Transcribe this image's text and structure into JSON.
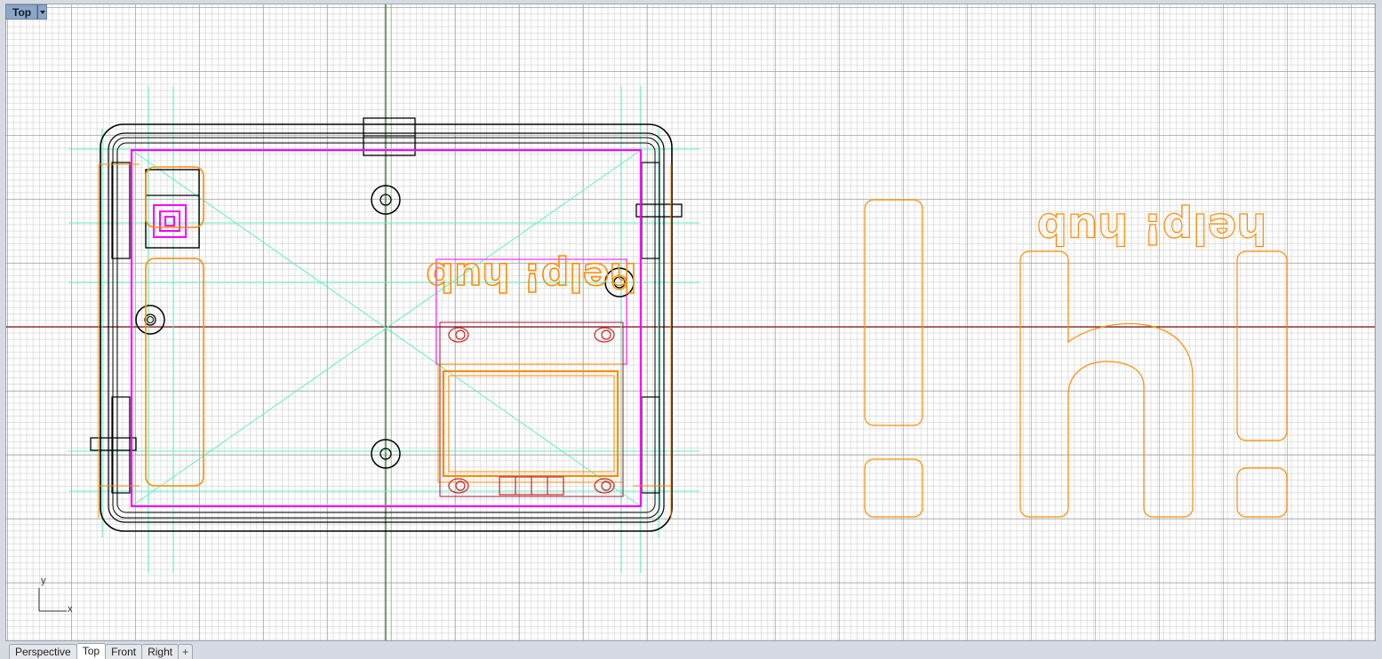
{
  "viewport": {
    "name": "Top",
    "text_mirrored": "help! hub",
    "big_text": "!h!",
    "axis_labels": {
      "y": "y",
      "x": "x"
    }
  },
  "tabs": [
    {
      "label": "Perspective",
      "active": false
    },
    {
      "label": "Top",
      "active": true
    },
    {
      "label": "Front",
      "active": false
    },
    {
      "label": "Right",
      "active": false
    }
  ],
  "add_tab_label": "+",
  "colors": {
    "background": "#ffffff",
    "grid_major": "#969696",
    "grid_minor": "#c8c8c8",
    "x_axis": "#8b1a1a",
    "y_axis": "#1f7a1f",
    "outline": "#000000",
    "orange": "#ff8c00",
    "magenta": "#ff00ff",
    "cyan": "#5ff0c4",
    "red": "#cc2222",
    "maroon": "#9a1a3a"
  }
}
